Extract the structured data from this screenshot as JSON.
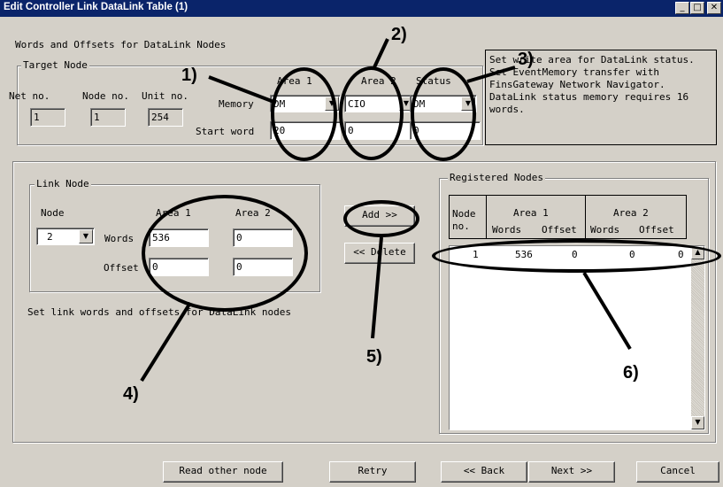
{
  "window": {
    "title": "Edit Controller Link DataLink Table (1)",
    "controls": {
      "minimize": "_",
      "maximize": "□",
      "close": "✕"
    }
  },
  "subtitle": "Words and Offsets for DataLink Nodes",
  "target_node": {
    "legend": "Target Node",
    "net_label": "Net no.",
    "node_label": "Node no.",
    "unit_label": "Unit no.",
    "net_value": "1",
    "node_value": "1",
    "unit_value": "254",
    "memory_label": "Memory",
    "start_word_label": "Start word",
    "columns": [
      "Area 1",
      "Area 2",
      "Status"
    ],
    "memory": [
      "DM",
      "CIO",
      "DM"
    ],
    "start_word": [
      "20",
      "0",
      "0"
    ]
  },
  "help_text": "Set write area for DataLink status.\nSet EventMemory transfer with FinsGateway Network Navigator.\nDataLink status memory requires 16 words.",
  "link_node": {
    "legend": "Link Node",
    "node_label": "Node",
    "node_value": "2",
    "area1_label": "Area 1",
    "area2_label": "Area 2",
    "words_label": "Words",
    "offset_label": "Offset",
    "area1_words": "536",
    "area2_words": "0",
    "area1_offset": "0",
    "area2_offset": "0"
  },
  "link_hint": "Set link words and offsets for DataLink nodes",
  "buttons": {
    "add": "Add >>",
    "delete": "<< Delete",
    "read_other": "Read other node",
    "retry": "Retry",
    "back": "<< Back",
    "next": "Next >>",
    "cancel": "Cancel"
  },
  "registered_nodes": {
    "legend": "Registered Nodes",
    "col_node_1": "Node",
    "col_node_2": "no.",
    "col_area1": "Area 1",
    "col_area2": "Area 2",
    "sub_words": "Words",
    "sub_offset": "Offset",
    "rows": [
      {
        "node": "1",
        "a1_words": "536",
        "a1_offset": "0",
        "a2_words": "0",
        "a2_offset": "0"
      }
    ]
  },
  "annotations": [
    "1)",
    "2)",
    "3)",
    "4)",
    "5)",
    "6)"
  ]
}
